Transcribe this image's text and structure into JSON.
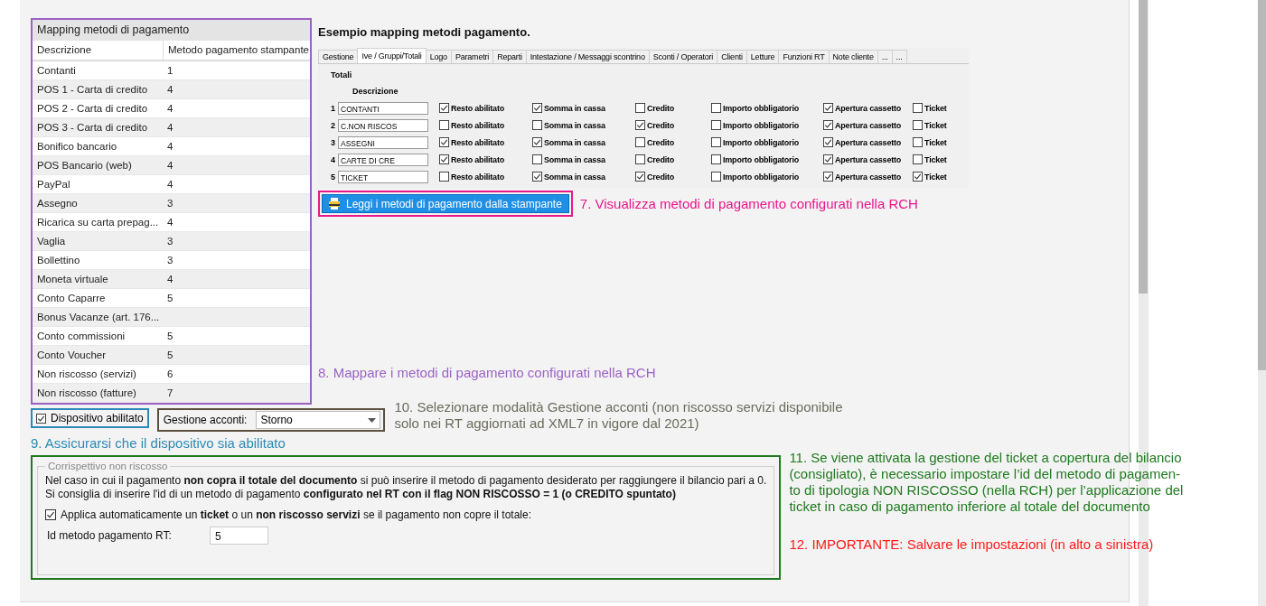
{
  "mapping_table": {
    "title": "Mapping metodi di pagamento",
    "columns": [
      "Descrizione",
      "Metodo pagamento stampante"
    ],
    "rows": [
      {
        "description": "Contanti",
        "method": "1"
      },
      {
        "description": "POS 1 - Carta di credito",
        "method": "4"
      },
      {
        "description": "POS 2 - Carta di credito",
        "method": "4"
      },
      {
        "description": "POS 3 - Carta di credito",
        "method": "4"
      },
      {
        "description": "Bonifico bancario",
        "method": "4"
      },
      {
        "description": "POS Bancario (web)",
        "method": "4"
      },
      {
        "description": "PayPal",
        "method": "4"
      },
      {
        "description": "Assegno",
        "method": "3"
      },
      {
        "description": "Ricarica su carta prepag...",
        "method": "4"
      },
      {
        "description": "Vaglia",
        "method": "3"
      },
      {
        "description": "Bollettino",
        "method": "3"
      },
      {
        "description": "Moneta virtuale",
        "method": "4"
      },
      {
        "description": "Conto Caparre",
        "method": "5"
      },
      {
        "description": "Bonus Vacanze (art. 176..."
      },
      {
        "description": "Conto commissioni",
        "method": "5"
      },
      {
        "description": "Conto Voucher",
        "method": "5"
      },
      {
        "description": "Non riscosso (servizi)",
        "method": "6"
      },
      {
        "description": "Non riscosso (fatture)",
        "method": "7"
      }
    ]
  },
  "example": {
    "title": "Esempio mapping metodi pagamento.",
    "tabs": [
      {
        "label": "Gestione",
        "selected": false
      },
      {
        "label": "Ive / Gruppi/Totali",
        "selected": true
      },
      {
        "label": "Logo",
        "selected": false
      },
      {
        "label": "Parametri",
        "selected": false
      },
      {
        "label": "Reparti",
        "selected": false
      },
      {
        "label": "Intestazione / Messaggi scontrino",
        "selected": false
      },
      {
        "label": "Sconti / Operatori",
        "selected": false
      },
      {
        "label": "Clienti",
        "selected": false
      },
      {
        "label": "Letture",
        "selected": false
      },
      {
        "label": "Funzioni RT",
        "selected": false
      },
      {
        "label": "Note cliente",
        "selected": false
      },
      {
        "label": "...",
        "selected": false
      },
      {
        "label": "...",
        "selected": false
      }
    ],
    "group": "Totali",
    "column_header": "Descrizione",
    "rows": [
      {
        "number": "1",
        "description": "CONTANTI",
        "options": [
          {
            "label": "Resto abilitato",
            "checked": true
          },
          {
            "label": "Somma in cassa",
            "checked": true
          },
          {
            "label": "Credito",
            "checked": false
          },
          {
            "label": "Importo obbligatorio",
            "checked": false
          },
          {
            "label": "Apertura cassetto",
            "checked": true
          },
          {
            "label": "Ticket",
            "checked": false
          }
        ]
      },
      {
        "number": "2",
        "description": "C.NON RISCOS",
        "options": [
          {
            "label": "Resto abilitato",
            "checked": false
          },
          {
            "label": "Somma in cassa",
            "checked": false
          },
          {
            "label": "Credito",
            "checked": true
          },
          {
            "label": "Importo obbligatorio",
            "checked": false
          },
          {
            "label": "Apertura cassetto",
            "checked": true
          },
          {
            "label": "Ticket",
            "checked": false
          }
        ]
      },
      {
        "number": "3",
        "description": "ASSEGNI",
        "options": [
          {
            "label": "Resto abilitato",
            "checked": true
          },
          {
            "label": "Somma in cassa",
            "checked": true
          },
          {
            "label": "Credito",
            "checked": false
          },
          {
            "label": "Importo obbligatorio",
            "checked": false
          },
          {
            "label": "Apertura cassetto",
            "checked": true
          },
          {
            "label": "Ticket",
            "checked": false
          }
        ]
      },
      {
        "number": "4",
        "description": "CARTE DI CRE",
        "options": [
          {
            "label": "Resto abilitato",
            "checked": true
          },
          {
            "label": "Somma in cassa",
            "checked": false
          },
          {
            "label": "Credito",
            "checked": false
          },
          {
            "label": "Importo obbligatorio",
            "checked": false
          },
          {
            "label": "Apertura cassetto",
            "checked": true
          },
          {
            "label": "Ticket",
            "checked": false
          }
        ]
      },
      {
        "number": "5",
        "description": "TICKET",
        "options": [
          {
            "label": "Resto abilitato",
            "checked": false
          },
          {
            "label": "Somma in cassa",
            "checked": true
          },
          {
            "label": "Credito",
            "checked": true
          },
          {
            "label": "Importo obbligatorio",
            "checked": false
          },
          {
            "label": "Apertura cassetto",
            "checked": true
          },
          {
            "label": "Ticket",
            "checked": true
          }
        ]
      }
    ],
    "read_button": "Leggi i metodi di pagamento dalla stampante"
  },
  "device_checkbox": {
    "label": "Dispositivo abilitato",
    "checked": true
  },
  "account_management": {
    "label": "Gestione acconti:",
    "value": "Storno"
  },
  "non_collected": {
    "legend": "Corrispettivo non riscosso",
    "lines": [
      "Nel caso in cui il pagamento **non copra il totale del documento** si può inserire il metodo di pagamento desiderato per raggiungere il bilancio pari a 0.",
      "Si consiglia di inserire l'id di un metodo di pagamento **configurato nel RT con il flag NON RISCOSSO = 1 (o CREDITO spuntato)**"
    ],
    "auto_checkbox": {
      "label": "Applica automaticamente un **ticket** o un **non riscosso servizi** se il pagamento non copre il totale:",
      "checked": true
    },
    "id_field": {
      "label": "Id metodo pagamento RT:",
      "value": "5"
    }
  },
  "annotations": [
    {
      "lines": [
        "7. Visualizza metodi di pagamento configurati nella RCH"
      ],
      "color": "#e8178a"
    },
    {
      "lines": [
        "8. Mappare i metodi di pagamento configurati nella RCH"
      ],
      "color": "#9b62c6"
    },
    {
      "lines": [
        "10. Selezionare modalità Gestione acconti (non riscosso servizi disponibile",
        "solo nei RT aggiornati ad XML7 in vigore dal 2021)"
      ],
      "color": "#6b6b5c"
    },
    {
      "lines": [
        "9. Assicurarsi che il dispositivo sia abilitato"
      ],
      "color": "#2a8ab8"
    },
    {
      "lines": [
        "11. Se viene attivata la gestione del ticket a copertura del bilancio",
        "(consigliato), è necessario impostare l’id del metodo di pagamen-",
        "to di tipologia NON RISCOSSO (nella RCH) per l’applicazione del",
        "ticket in caso di pagamento inferiore al totale del documento"
      ],
      "color": "#1f7a1f"
    },
    {
      "lines": [
        "12. IMPORTANTE: Salvare le impostazioni (in alto a sinistra)"
      ],
      "color": "#ff1a1a"
    }
  ]
}
